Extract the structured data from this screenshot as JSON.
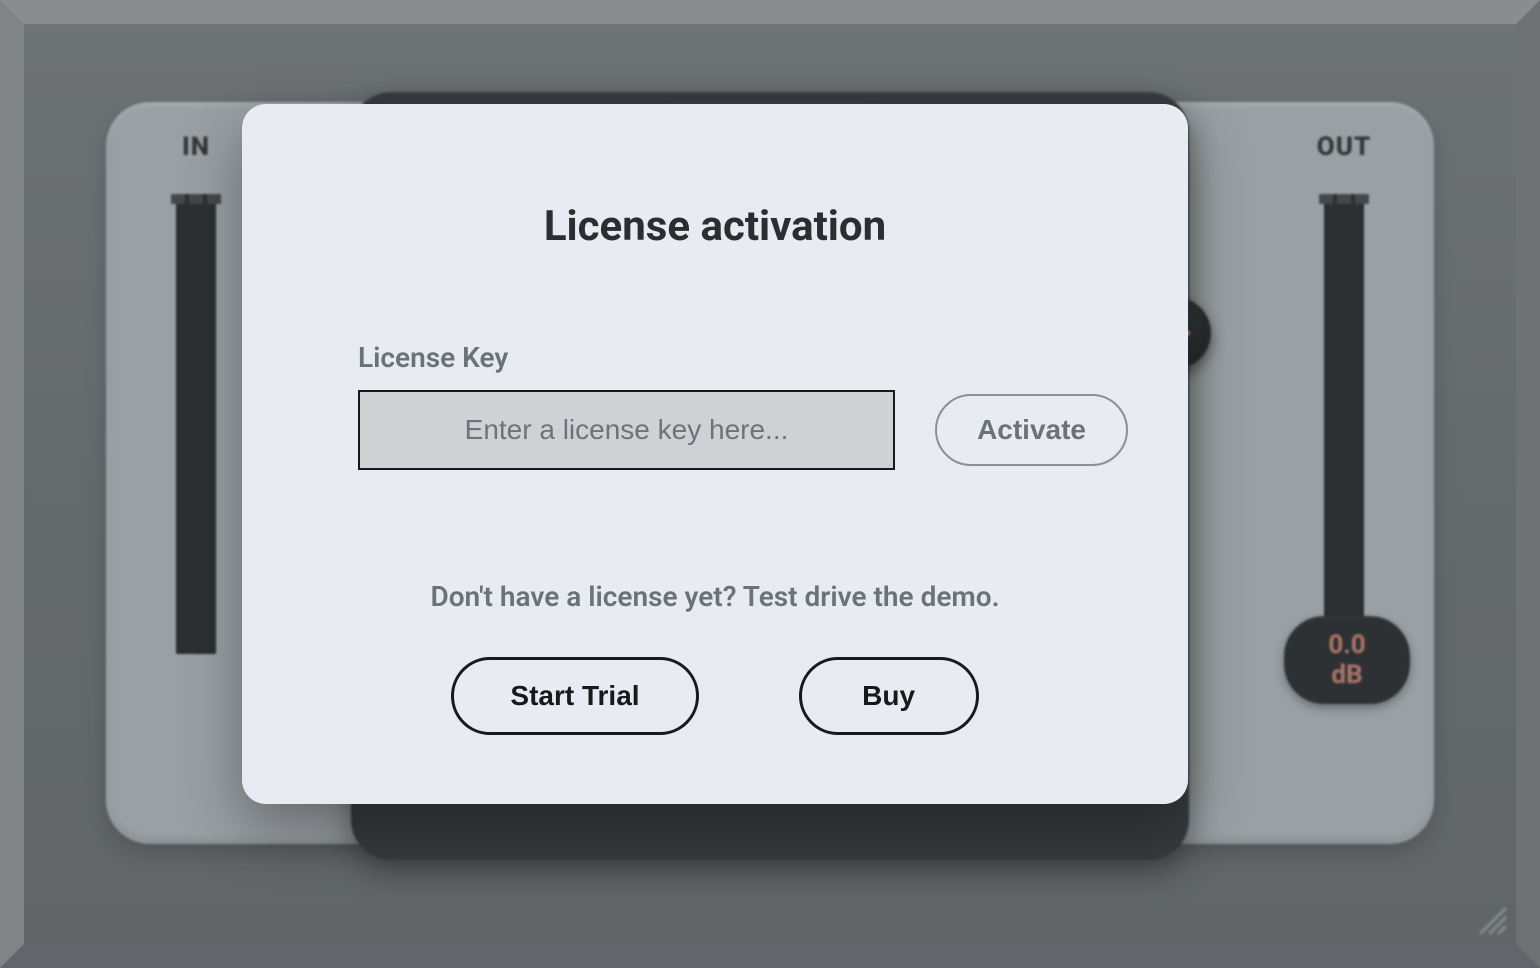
{
  "meters": {
    "in_label": "IN",
    "out_label": "OUT"
  },
  "output": {
    "db_readout": "0.0 dB"
  },
  "modal": {
    "title": "License activation",
    "field_label": "License Key",
    "key_placeholder": "Enter a license key here...",
    "key_value": "",
    "activate_label": "Activate",
    "demo_text": "Don't have a license yet? Test drive the demo.",
    "start_trial_label": "Start Trial",
    "buy_label": "Buy"
  }
}
